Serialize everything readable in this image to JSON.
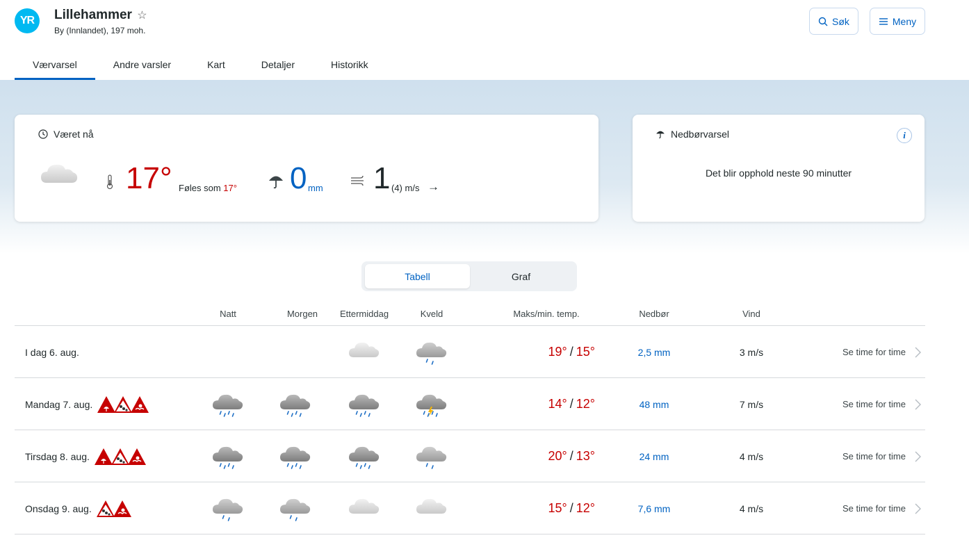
{
  "header": {
    "logo_text": "YR",
    "location_name": "Lillehammer",
    "location_star": "☆",
    "location_sub": "By (Innlandet), 197 moh.",
    "search_label": "Søk",
    "menu_label": "Meny"
  },
  "tabs": [
    {
      "label": "Værvarsel",
      "active": true
    },
    {
      "label": "Andre varsler",
      "active": false
    },
    {
      "label": "Kart",
      "active": false
    },
    {
      "label": "Detaljer",
      "active": false
    },
    {
      "label": "Historikk",
      "active": false
    }
  ],
  "now": {
    "heading": "Været nå",
    "icon": "cloud-icon",
    "temperature": "17°",
    "feels_like_label": "Føles som",
    "feels_like_value": "17°",
    "precipitation": "0",
    "precipitation_unit": "mm",
    "wind": "1",
    "wind_detail": "(4) m/s",
    "wind_arrow": "→"
  },
  "precip_card": {
    "heading": "Nedbørvarsel",
    "info": "i",
    "message": "Det blir opphold neste 90 minutter"
  },
  "view_toggle": {
    "table": "Tabell",
    "graph": "Graf",
    "selected": "Tabell"
  },
  "table": {
    "headers": {
      "night": "Natt",
      "morning": "Morgen",
      "afternoon": "Ettermiddag",
      "evening": "Kveld",
      "temp": "Maks/min. temp.",
      "precip": "Nedbør",
      "wind": "Vind"
    },
    "rows": [
      {
        "day": "I dag 6. aug.",
        "warnings": [],
        "icons": [
          "",
          "",
          "cloud-icon",
          "light-rain-icon"
        ],
        "max": "19°",
        "min": "15°",
        "precip": "2,5 mm",
        "wind": "3 m/s",
        "link": "Se time for time"
      },
      {
        "day": "Mandag 7. aug.",
        "warnings": [
          "rain-warning-icon",
          "landslide-warning-icon",
          "flood-warning-icon"
        ],
        "icons": [
          "heavy-rain-icon",
          "heavy-rain-icon",
          "heavy-rain-icon",
          "thunder-rain-icon"
        ],
        "max": "14°",
        "min": "12°",
        "precip": "48 mm",
        "wind": "7 m/s",
        "link": "Se time for time"
      },
      {
        "day": "Tirsdag 8. aug.",
        "warnings": [
          "rain-warning-icon",
          "landslide-warning-icon",
          "flood-warning-icon"
        ],
        "icons": [
          "heavy-rain-icon",
          "heavy-rain-icon",
          "heavy-rain-icon",
          "light-rain-icon"
        ],
        "max": "20°",
        "min": "13°",
        "precip": "24 mm",
        "wind": "4 m/s",
        "link": "Se time for time"
      },
      {
        "day": "Onsdag 9. aug.",
        "warnings": [
          "landslide-warning-icon",
          "flood-warning-icon"
        ],
        "icons": [
          "light-rain-icon",
          "light-rain-icon",
          "cloud-icon",
          "cloud-icon"
        ],
        "max": "15°",
        "min": "12°",
        "precip": "7,6 mm",
        "wind": "4 m/s",
        "link": "Se time for time"
      }
    ]
  },
  "colors": {
    "accent": "#0062c2",
    "warm": "#c60000",
    "warning": "#c60000",
    "logo": "#00b9f1"
  }
}
